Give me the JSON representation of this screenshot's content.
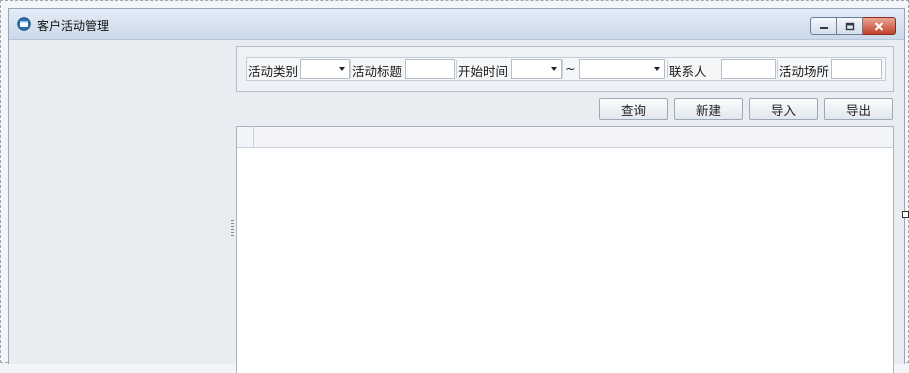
{
  "window": {
    "title": "客户活动管理",
    "icon": "app-window-icon"
  },
  "filters": {
    "activity_type_label": "活动类别",
    "activity_type_value": "",
    "activity_title_label": "活动标题",
    "activity_title_value": "",
    "start_time_label": "开始时间",
    "start_time_from": "",
    "range_separator": "~",
    "start_time_to": "",
    "contact_label": "联系人",
    "contact_value": "",
    "venue_label": "活动场所",
    "venue_value": ""
  },
  "toolbar": {
    "query_label": "查询",
    "new_label": "新建",
    "import_label": "导入",
    "export_label": "导出"
  },
  "grid": {
    "columns": [],
    "rows": []
  },
  "colors": {
    "titlebar": "#cbd9ea",
    "close_button": "#c4422c",
    "window_bg": "#e9edf2"
  }
}
